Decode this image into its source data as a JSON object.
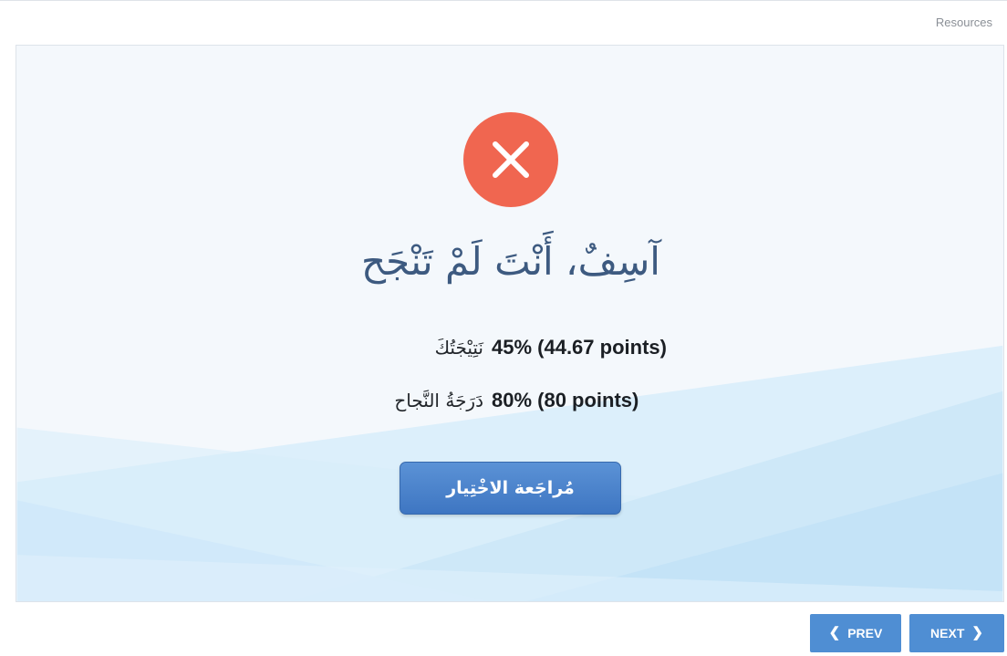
{
  "header": {
    "resources_label": "Resources"
  },
  "result": {
    "status_icon": "close-icon",
    "title": "آسِفٌ، أَنْتَ لَمْ تَنْجَح",
    "score": {
      "value": "45% (44.67 points)",
      "label": "نَتِيْجَتُكَ"
    },
    "passing": {
      "value": "80% (80 points)",
      "label": "دَرَجَةُ النَّجاح"
    },
    "review_button_label": "مُراجَعة الاخْتِيار"
  },
  "navigation": {
    "prev_label": "PREV",
    "next_label": "NEXT",
    "prev_icon": "chevron-left-icon",
    "next_icon": "chevron-right-icon"
  },
  "colors": {
    "fail_badge": "#f06650",
    "title_text": "#3d5a80",
    "button_blue": "#4f8ed3",
    "slide_background": "#f4f8fc"
  }
}
